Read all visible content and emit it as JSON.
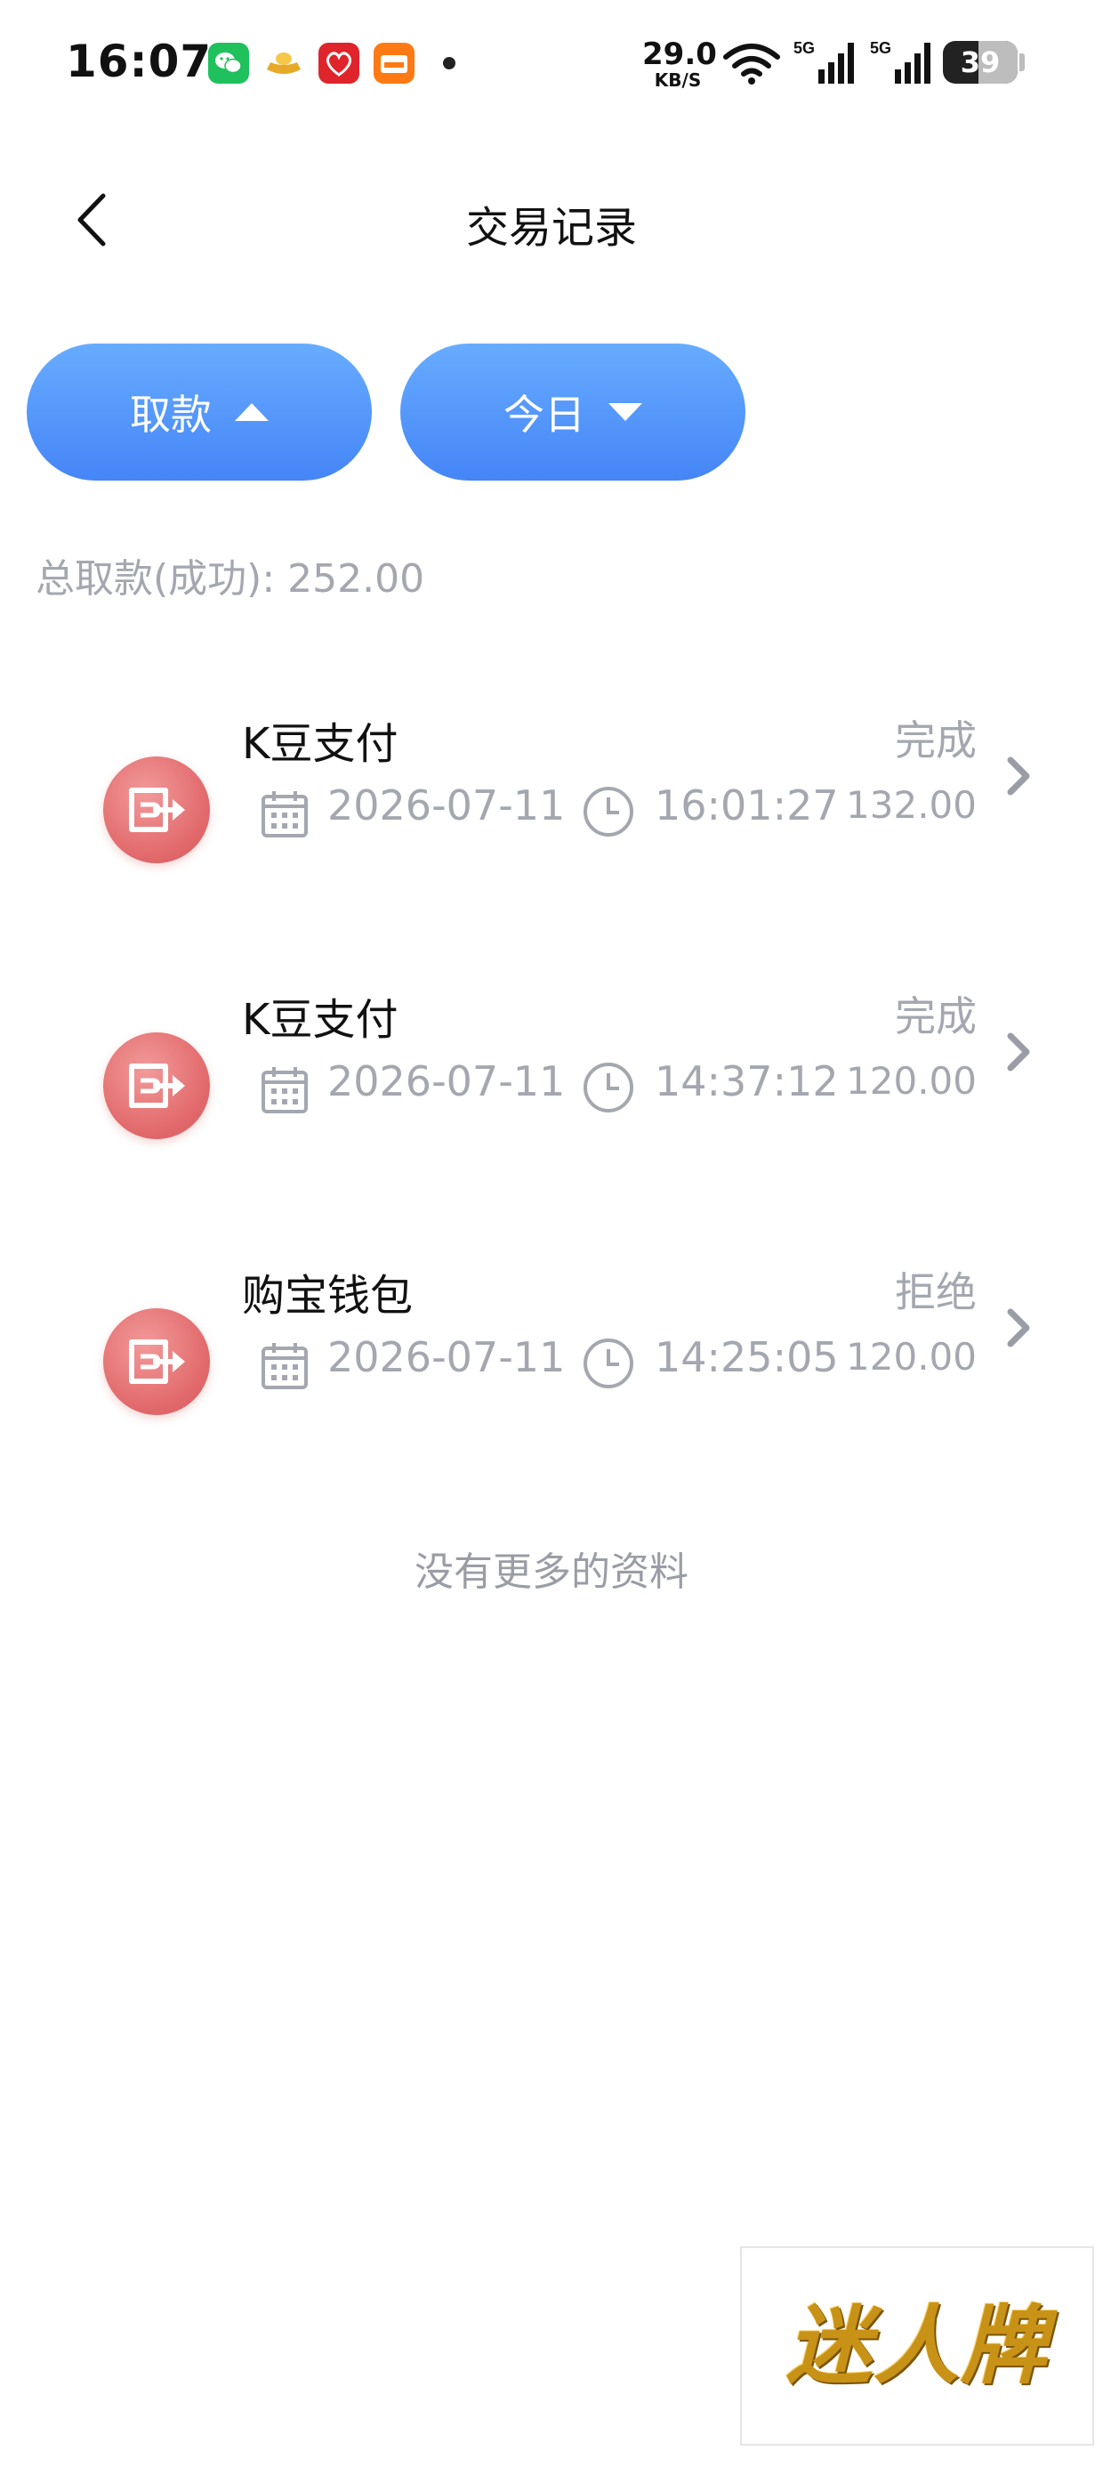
{
  "status_bar": {
    "time": "16:07",
    "net_speed": "29.0",
    "net_speed_unit": "KB/S",
    "signal_label": "5G",
    "battery_level": "39",
    "app_icons": [
      "wechat-icon",
      "gold-ingot-icon",
      "red-app-icon",
      "hot-app-icon"
    ]
  },
  "header": {
    "title": "交易记录",
    "back_icon": "chevron-left-icon"
  },
  "filters": {
    "type_label": "取款",
    "range_label": "今日",
    "accent_top": "#67acff",
    "accent_bottom": "#4585f7"
  },
  "summary": {
    "text": "总取款(成功): 252.00"
  },
  "records": [
    {
      "title": "K豆支付",
      "status": "完成",
      "date": "2026-07-11",
      "time": "16:01:27",
      "amount": "132.00"
    },
    {
      "title": "K豆支付",
      "status": "完成",
      "date": "2026-07-11",
      "time": "14:37:12",
      "amount": "120.00"
    },
    {
      "title": "购宝钱包",
      "status": "拒绝",
      "date": "2026-07-11",
      "time": "14:25:05",
      "amount": "120.00"
    }
  ],
  "footer": {
    "no_more": "没有更多的资料"
  },
  "watermark": {
    "text": "迷人牌"
  },
  "colors": {
    "muted_text": "#a4a7b0",
    "record_icon": "#e26a6c"
  }
}
